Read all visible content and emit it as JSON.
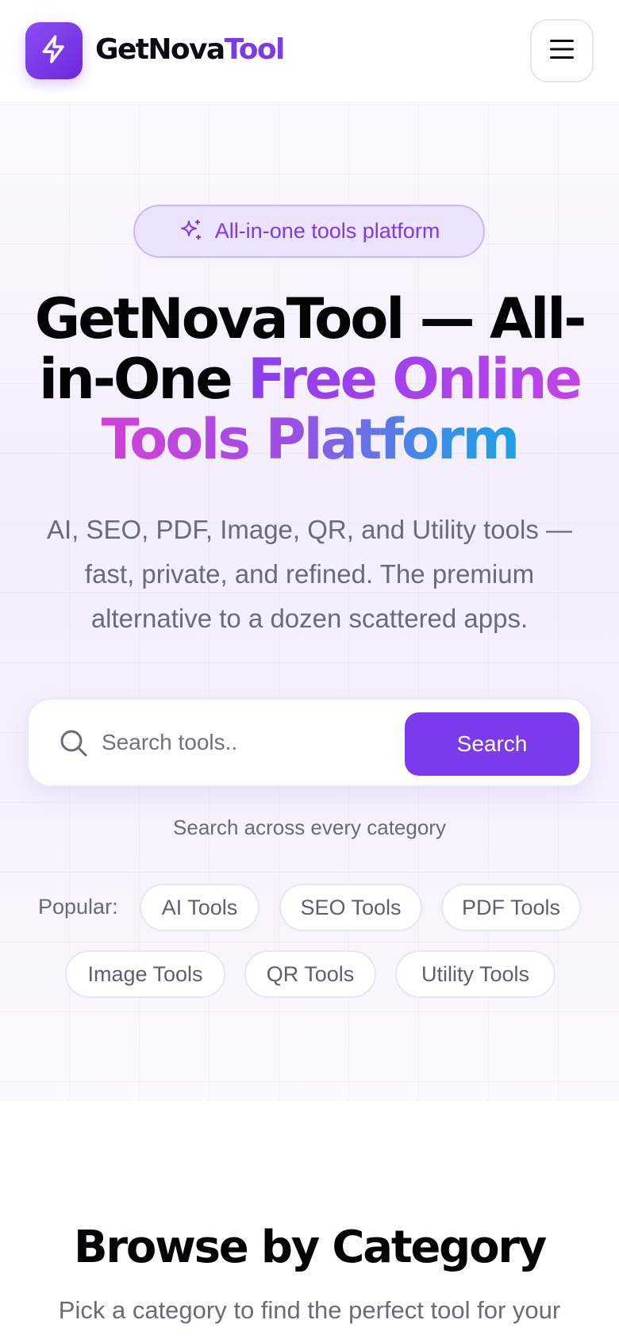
{
  "header": {
    "brand_part1": "GetNova",
    "brand_part2": "Tool",
    "logo_icon": "bolt-icon",
    "menu_icon": "hamburger-menu-icon"
  },
  "hero": {
    "badge_text": "All-in-one tools platform",
    "badge_icon": "sparkles-icon",
    "title_plain_1": "GetNovaTool — All-in-One ",
    "title_grad_1": "Free Online",
    "title_grad_2": "Tools Platform",
    "subtitle": "AI, SEO, PDF, Image, QR, and Utility tools — fast, private, and refined. The premium alternative to a dozen scattered apps."
  },
  "search": {
    "placeholder": "Search tools..",
    "button_label": "Search",
    "helper": "Search across every category"
  },
  "popular": {
    "label": "Popular:",
    "chips": [
      "AI Tools",
      "SEO Tools",
      "PDF Tools",
      "Image Tools",
      "QR Tools",
      "Utility Tools"
    ]
  },
  "browse": {
    "title": "Browse by Category",
    "subtitle": "Pick a category to find the perfect tool for your"
  },
  "colors": {
    "accent": "#7c3aed",
    "text_dark": "#050508",
    "text_muted": "#6b6b78"
  }
}
